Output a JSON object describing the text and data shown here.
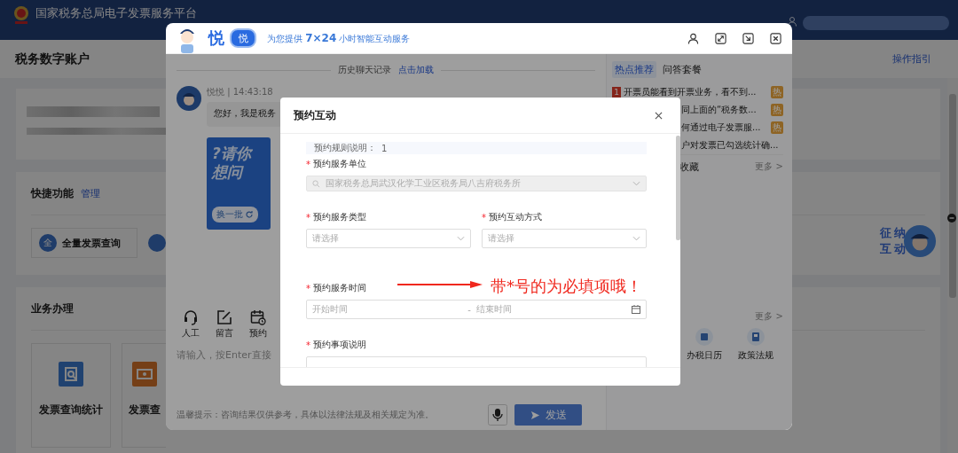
{
  "site": {
    "title": "国家税务总局电子发票服务平台"
  },
  "page": {
    "title": "税务数字账户",
    "guide_link": "操作指引",
    "quick": {
      "title": "快捷功能",
      "manage": "管理",
      "items": [
        {
          "icon_char": "全",
          "label": "全量发票查询"
        }
      ]
    },
    "business": {
      "title": "业务办理",
      "items": [
        {
          "kind": "search",
          "label": "发票查询统计"
        },
        {
          "kind": "ticket",
          "label": "发票查"
        }
      ]
    },
    "float_badge": {
      "chars": [
        "征",
        "纳",
        "互",
        "动"
      ]
    }
  },
  "chat": {
    "brand": "悦",
    "brand_badge": "悦",
    "tagline": "为您提供 **7×24** 小时智能互动服务",
    "history": {
      "label": "历史聊天记录",
      "link": "点击加载"
    },
    "message": {
      "sender": "悦悦 | 14:43:18",
      "text": "您好，我是税务"
    },
    "banner": {
      "lines": [
        "?请你",
        "想问"
      ],
      "button": "换一批"
    },
    "tools": [
      {
        "kind": "agent",
        "label": "人工"
      },
      {
        "kind": "note",
        "label": "留言"
      },
      {
        "kind": "schedule",
        "label": "预约"
      }
    ],
    "input": {
      "placeholder": "请输入，按Enter直接"
    },
    "notice": "温馨提示：咨询结果仅供参考，具体以法律法规及相关规定为准。",
    "send": "发送",
    "panel": {
      "tabs": [
        {
          "label": "热点推荐",
          "selected": true
        },
        {
          "label": "问答套餐",
          "selected": false
        }
      ],
      "hot_items": [
        {
          "rank": "1",
          "text": "开票员能看到开票业务，看不到...",
          "badge": "热"
        },
        {
          "text": "同上面的“税务数...",
          "badge": "热"
        },
        {
          "text": "何通过电子发票服...",
          "badge": "热"
        },
        {
          "text": "户对发票已勾选统计确..."
        }
      ],
      "favorites": {
        "title": "收藏",
        "more": "更多 >"
      },
      "services": {
        "more": "更多 >",
        "items": [
          {
            "kind": "calendar",
            "label": "办税日历"
          },
          {
            "kind": "law",
            "label": "政策法规"
          }
        ]
      }
    }
  },
  "modal": {
    "title": "预约互动",
    "rule": {
      "label": "预约规则说明：",
      "value": "1"
    },
    "rows": [
      [
        {
          "kind": "search-select",
          "required_mark": "*",
          "label": "预约服务单位",
          "value": "国家税务总局武汉化学工业区税务局八吉府税务所",
          "disabled": true
        }
      ],
      [
        {
          "kind": "select",
          "required_mark": "*",
          "label": "预约服务类型",
          "placeholder": "请选择",
          "disabled": false
        },
        {
          "kind": "select",
          "required_mark": "*",
          "label": "预约互动方式",
          "placeholder": "请选择",
          "disabled": false
        }
      ],
      [
        {
          "kind": "date-range",
          "required_mark": "*",
          "label": "预约服务时间",
          "start_placeholder": "开始时间",
          "separator": "-",
          "end_placeholder": "结束时间"
        }
      ],
      [
        {
          "kind": "textarea",
          "required_mark": "*",
          "label": "预约事项说明"
        }
      ]
    ]
  },
  "annotation": {
    "text": "带*号的为必填项哦！"
  }
}
